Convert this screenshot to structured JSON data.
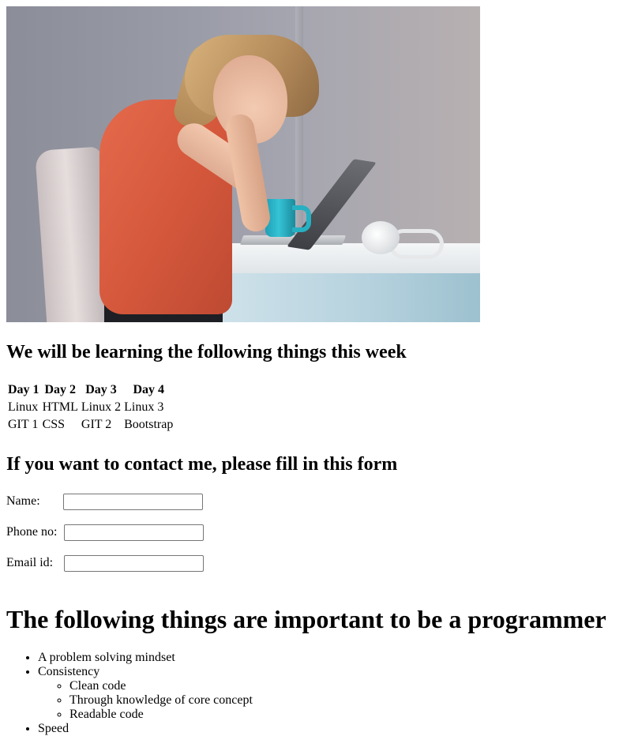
{
  "hero_image": {
    "alt": "Woman stressed in front of a laptop"
  },
  "schedule_section": {
    "title": "We will be learning the following things this week",
    "headers": [
      "Day 1",
      "Day 2",
      "Day 3",
      "Day 4"
    ],
    "rows": [
      [
        "Linux",
        "HTML",
        "Linux 2",
        "Linux 3"
      ],
      [
        "GIT 1",
        "CSS",
        "GIT 2",
        "Bootstrap"
      ]
    ]
  },
  "contact_section": {
    "title": "If you want to contact me, please fill in this form",
    "fields": [
      {
        "label": "Name:",
        "value": "",
        "placeholder": ""
      },
      {
        "label": "Phone no:",
        "value": "",
        "placeholder": ""
      },
      {
        "label": "Email id:",
        "value": "",
        "placeholder": ""
      }
    ]
  },
  "programmer_section": {
    "title": "The following things are important to be a programmer",
    "items": [
      {
        "text": "A problem solving mindset"
      },
      {
        "text": "Consistency",
        "subitems": [
          "Clean code",
          "Through knowledge of core concept",
          "Readable code"
        ]
      },
      {
        "text": "Speed"
      }
    ]
  }
}
